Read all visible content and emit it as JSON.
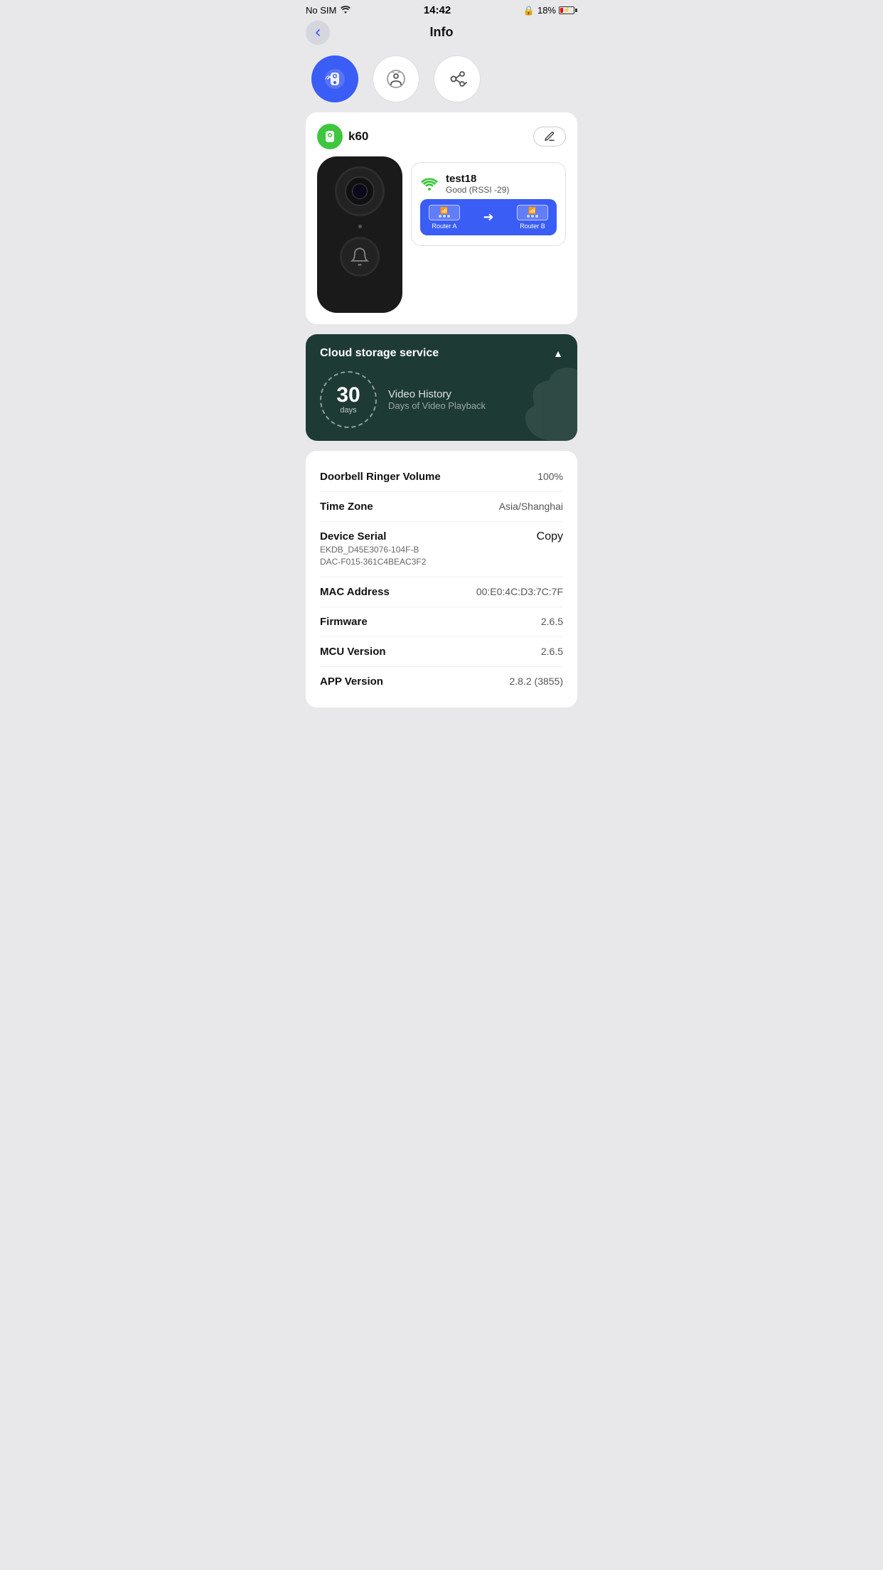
{
  "statusBar": {
    "carrier": "No SIM",
    "time": "14:42",
    "battery": "18%",
    "lockIcon": "🔒"
  },
  "header": {
    "title": "Info",
    "backLabel": "Back"
  },
  "tabs": [
    {
      "id": "info",
      "label": "Info",
      "active": true
    },
    {
      "id": "activity",
      "label": "Activity",
      "active": false
    },
    {
      "id": "share",
      "label": "Share",
      "active": false
    }
  ],
  "device": {
    "name": "k60",
    "editLabel": "✏",
    "wifi": {
      "ssid": "test18",
      "quality": "Good (RSSI -29)",
      "routerALabel": "Router A",
      "routerBLabel": "Router B"
    }
  },
  "cloudStorage": {
    "title": "Cloud storage service",
    "arrowLabel": "▲",
    "days": "30",
    "daysLabel": "days",
    "videoHistory": "Video History",
    "videoSub": "Days of Video Playback"
  },
  "infoRows": [
    {
      "label": "Doorbell Ringer Volume",
      "sub": "",
      "value": "100%",
      "isCopy": false
    },
    {
      "label": "Time Zone",
      "sub": "",
      "value": "Asia/Shanghai",
      "isCopy": false
    },
    {
      "label": "Device Serial",
      "sub": "EKDB_D45E3076-104F-B\nDAC-F015-361C4BEAC3F2",
      "value": "Copy",
      "isCopy": true
    },
    {
      "label": "MAC Address",
      "sub": "",
      "value": "00:E0:4C:D3:7C:7F",
      "isCopy": false
    },
    {
      "label": "Firmware",
      "sub": "",
      "value": "2.6.5",
      "isCopy": false
    },
    {
      "label": "MCU Version",
      "sub": "",
      "value": "2.6.5",
      "isCopy": false
    },
    {
      "label": "APP Version",
      "sub": "",
      "value": "2.8.2 (3855)",
      "isCopy": false
    }
  ]
}
